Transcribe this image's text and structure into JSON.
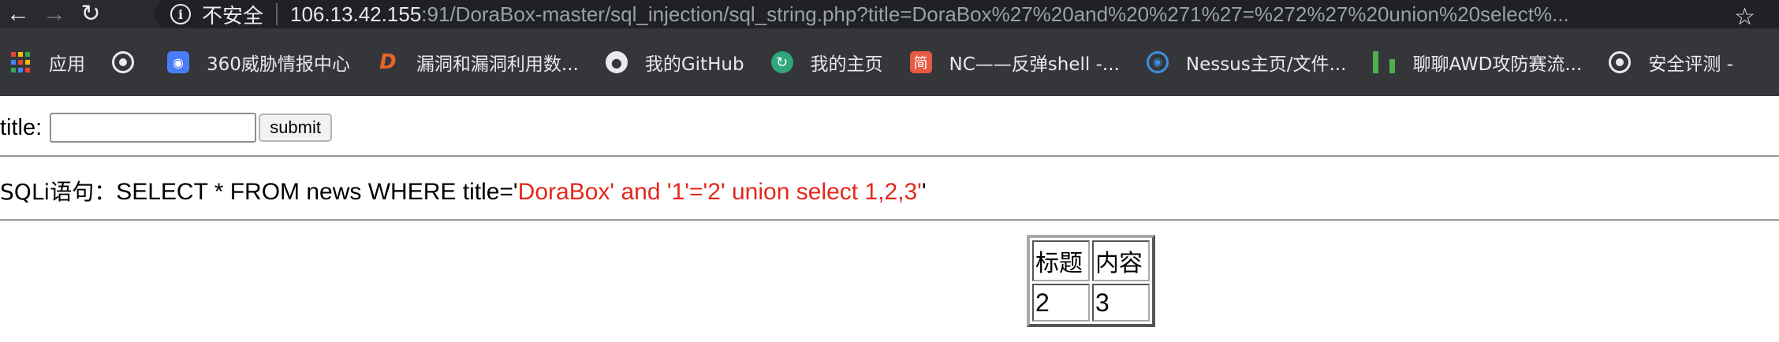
{
  "browser": {
    "url_host": "106.13.42.155",
    "url_rest": ":91/DoraBox-master/sql_injection/sql_string.php?title=DoraBox%27%20and%20%271%27=%272%27%20union%20select%...",
    "security_label": "不安全",
    "icons": {
      "back": "back-arrow-icon",
      "forward": "forward-arrow-icon",
      "reload": "reload-icon",
      "info": "info-icon",
      "star": "bookmark-star-icon"
    }
  },
  "bookmarks": [
    {
      "label": "应用",
      "icon": "apps-grid-icon"
    },
    {
      "label": "",
      "icon": "globe-icon"
    },
    {
      "label": "360威胁情报中心",
      "icon": "shield-icon"
    },
    {
      "label": "漏洞和漏洞利用数...",
      "icon": "dorabox-logo-icon"
    },
    {
      "label": "我的GitHub",
      "icon": "github-icon"
    },
    {
      "label": "我的主页",
      "icon": "swirl-icon"
    },
    {
      "label": "NC——反弹shell -...",
      "icon": "jian-icon"
    },
    {
      "label": "Nessus主页/文件...",
      "icon": "nessus-icon"
    },
    {
      "label": "聊聊AWD攻防赛流...",
      "icon": "bars-icon"
    },
    {
      "label": "安全评测 -",
      "icon": "globe-icon"
    }
  ],
  "form": {
    "label": "title:",
    "input_value": "",
    "submit_label": "submit"
  },
  "sql": {
    "prefix": "SQLi语句：",
    "query_start": "SELECT * FROM news WHERE title='",
    "payload": "DoraBox' and '1'='2' union select 1,2,3'",
    "query_end": "'"
  },
  "result_table": {
    "headers": [
      "标题",
      "内容"
    ],
    "rows": [
      [
        "2",
        "3"
      ]
    ]
  },
  "colors": {
    "payload": "#e3281c",
    "toolbar": "#292a2d",
    "bookmark_bar": "#35363a"
  }
}
